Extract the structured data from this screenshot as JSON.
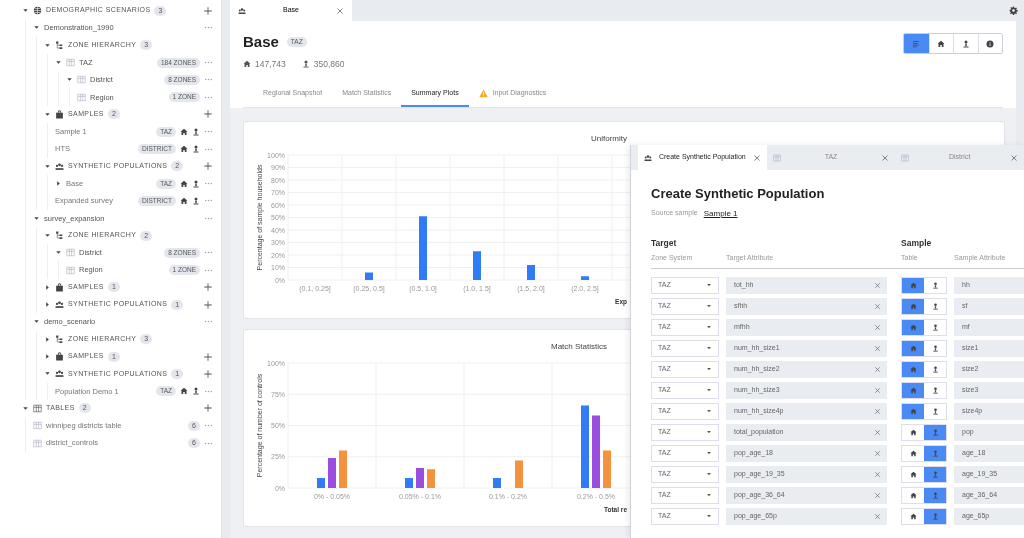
{
  "sidebar": {
    "items": [
      {
        "kind": "scenario-section",
        "label": "DEMOGRAPHIC SCENARIOS",
        "count": "3",
        "expanded": true,
        "children": [
          {
            "kind": "scenario",
            "label": "Demonstration_1990",
            "expanded": true,
            "children": [
              {
                "kind": "zone-group",
                "label": "ZONE HIERARCHY",
                "count": "3",
                "expanded": true,
                "children": [
                  {
                    "kind": "zone",
                    "label": "TAZ",
                    "badge": "184 ZONES",
                    "expanded": true,
                    "children": [
                      {
                        "kind": "zone",
                        "label": "District",
                        "badge": "8 ZONES",
                        "expanded": true,
                        "children": [
                          {
                            "kind": "zone",
                            "label": "Region",
                            "badge": "1 ZONE"
                          }
                        ]
                      }
                    ]
                  }
                ]
              },
              {
                "kind": "sample-group",
                "label": "SAMPLES",
                "count": "2",
                "expanded": true,
                "children": [
                  {
                    "kind": "sample",
                    "label": "Sample 1",
                    "badge": "TAZ"
                  },
                  {
                    "kind": "sample",
                    "label": "HTS",
                    "badge": "DISTRICT"
                  }
                ]
              },
              {
                "kind": "population-group",
                "label": "SYNTHETIC POPULATIONS",
                "count": "2",
                "expanded": true,
                "children": [
                  {
                    "kind": "population",
                    "label": "Base",
                    "badge": "TAZ",
                    "expanded": false
                  },
                  {
                    "kind": "population",
                    "label": "Expanded survey",
                    "badge": "DISTRICT"
                  }
                ]
              }
            ]
          },
          {
            "kind": "scenario",
            "label": "survey_expansion",
            "expanded": true,
            "children": [
              {
                "kind": "zone-group",
                "label": "ZONE HIERARCHY",
                "count": "2",
                "expanded": true,
                "children": [
                  {
                    "kind": "zone",
                    "label": "District",
                    "badge": "8 ZONES",
                    "expanded": true,
                    "children": [
                      {
                        "kind": "zone",
                        "label": "Region",
                        "badge": "1 ZONE"
                      }
                    ]
                  }
                ]
              },
              {
                "kind": "sample-group",
                "label": "SAMPLES",
                "count": "1",
                "expanded": false
              },
              {
                "kind": "population-group",
                "label": "SYNTHETIC POPULATIONS",
                "count": "1",
                "expanded": false
              }
            ]
          },
          {
            "kind": "scenario",
            "label": "demo_scenario",
            "expanded": true,
            "children": [
              {
                "kind": "zone-group",
                "label": "ZONE HIERARCHY",
                "count": "3",
                "expanded": false
              },
              {
                "kind": "sample-group",
                "label": "SAMPLES",
                "count": "1",
                "expanded": false
              },
              {
                "kind": "population-group",
                "label": "SYNTHETIC POPULATIONS",
                "count": "1",
                "expanded": true,
                "children": [
                  {
                    "kind": "population",
                    "label": "Population Demo 1",
                    "badge": "TAZ"
                  }
                ]
              }
            ]
          }
        ]
      },
      {
        "kind": "table-section",
        "label": "TABLES",
        "count": "2",
        "expanded": true,
        "children": [
          {
            "kind": "table",
            "label": "winnipeg districts table",
            "count": "6"
          },
          {
            "kind": "table",
            "label": "district_controls",
            "count": "6"
          }
        ]
      }
    ]
  },
  "doc_tabs": [
    {
      "label": "Base",
      "selected": true
    }
  ],
  "header": {
    "title": "Base",
    "badge": "TAZ",
    "households": "147,743",
    "persons": "350,860"
  },
  "view_buttons": [
    {
      "kind": "list",
      "selected": true
    },
    {
      "kind": "house",
      "selected": false
    },
    {
      "kind": "person",
      "selected": false
    },
    {
      "kind": "info",
      "selected": false
    }
  ],
  "tabs": [
    {
      "label": "Regional Snapshot",
      "selected": false,
      "warning": false
    },
    {
      "label": "Match Statistics",
      "selected": false,
      "warning": false
    },
    {
      "label": "Summary Plots",
      "selected": true,
      "warning": false
    },
    {
      "label": "Input Diagnostics",
      "selected": false,
      "warning": true
    }
  ],
  "charts": [
    {
      "chart_data": {
        "type": "bar",
        "grid": true,
        "title": "Uniformity",
        "xlabel": "Exp",
        "ylabel": "Percentage of sample households",
        "categories": [
          "(0.1, 0.25]",
          "(0.25, 0.5]",
          "(0.5, 1.0]",
          "(1.0, 1.5]",
          "(1.5, 2.0]",
          "(2.0, 2.5]"
        ],
        "ylim": [
          0,
          100
        ],
        "yticks": [
          {
            "value": 0,
            "label": "0%"
          },
          {
            "value": 10,
            "label": "10%"
          },
          {
            "value": 20,
            "label": "20%"
          },
          {
            "value": 30,
            "label": "30%"
          },
          {
            "value": 40,
            "label": "40%"
          },
          {
            "value": 50,
            "label": "50%"
          },
          {
            "value": 60,
            "label": "60%"
          },
          {
            "value": 70,
            "label": "70%"
          },
          {
            "value": 80,
            "label": "80%"
          },
          {
            "value": 90,
            "label": "90%"
          },
          {
            "value": 100,
            "label": "100%"
          }
        ],
        "series": [
          {
            "color": "#2f7cf6",
            "values": [
              0,
              6,
              51,
              23,
              12,
              3
            ]
          }
        ]
      }
    },
    {
      "chart_data": {
        "type": "bar",
        "grid": true,
        "title": "Match Statistics",
        "xlabel": "Total re",
        "ylabel": "Percentage of number of controls",
        "categories": [
          "0% - 0.05%",
          "0.05% - 0.1%",
          "0.1% - 0.2%",
          "0.2% - 0.5%"
        ],
        "ylim": [
          0,
          100
        ],
        "yticks": [
          {
            "value": 0,
            "label": "0%"
          },
          {
            "value": 25,
            "label": "25%"
          },
          {
            "value": 50,
            "label": "50%"
          },
          {
            "value": 75,
            "label": "75%"
          },
          {
            "value": 100,
            "label": "100%"
          }
        ],
        "series": [
          {
            "color": "#2f7cf6",
            "values": [
              8,
              8,
              8,
              66
            ]
          },
          {
            "color": "#9b4de0",
            "values": [
              24,
              16,
              null,
              58
            ]
          },
          {
            "color": "#f5923e",
            "values": [
              30,
              15,
              22,
              30
            ]
          }
        ]
      }
    }
  ],
  "dialog": {
    "tabs": [
      {
        "kind": "population",
        "label": "Create Synthetic Population",
        "selected": true
      },
      {
        "kind": "table",
        "label": "TAZ",
        "selected": false
      },
      {
        "kind": "table",
        "label": "District",
        "selected": false
      }
    ],
    "title": "Create Synthetic Population",
    "source_label": "Source sample",
    "source_link": "Sample 1",
    "target_heading": "Target",
    "sample_heading": "Sample",
    "columns": [
      "Zone System",
      "Target Attribute",
      "Table",
      "Sample Attribute"
    ],
    "rows": [
      {
        "zone": "TAZ",
        "target": "tot_hh",
        "household_selected": true,
        "sample": "hh"
      },
      {
        "zone": "TAZ",
        "target": "sfhh",
        "household_selected": true,
        "sample": "sf"
      },
      {
        "zone": "TAZ",
        "target": "mfhh",
        "household_selected": true,
        "sample": "mf"
      },
      {
        "zone": "TAZ",
        "target": "num_hh_size1",
        "household_selected": true,
        "sample": "size1"
      },
      {
        "zone": "TAZ",
        "target": "num_hh_size2",
        "household_selected": true,
        "sample": "size2"
      },
      {
        "zone": "TAZ",
        "target": "num_hh_size3",
        "household_selected": true,
        "sample": "size3"
      },
      {
        "zone": "TAZ",
        "target": "num_hh_size4p",
        "household_selected": true,
        "sample": "size4p"
      },
      {
        "zone": "TAZ",
        "target": "total_population",
        "household_selected": false,
        "sample": "pop"
      },
      {
        "zone": "TAZ",
        "target": "pop_age_18",
        "household_selected": false,
        "sample": "age_18"
      },
      {
        "zone": "TAZ",
        "target": "pop_age_19_35",
        "household_selected": false,
        "sample": "age_19_35"
      },
      {
        "zone": "TAZ",
        "target": "pop_age_36_64",
        "household_selected": false,
        "sample": "age_36_64"
      },
      {
        "zone": "TAZ",
        "target": "pop_age_65p",
        "household_selected": false,
        "sample": "age_65p"
      }
    ]
  }
}
